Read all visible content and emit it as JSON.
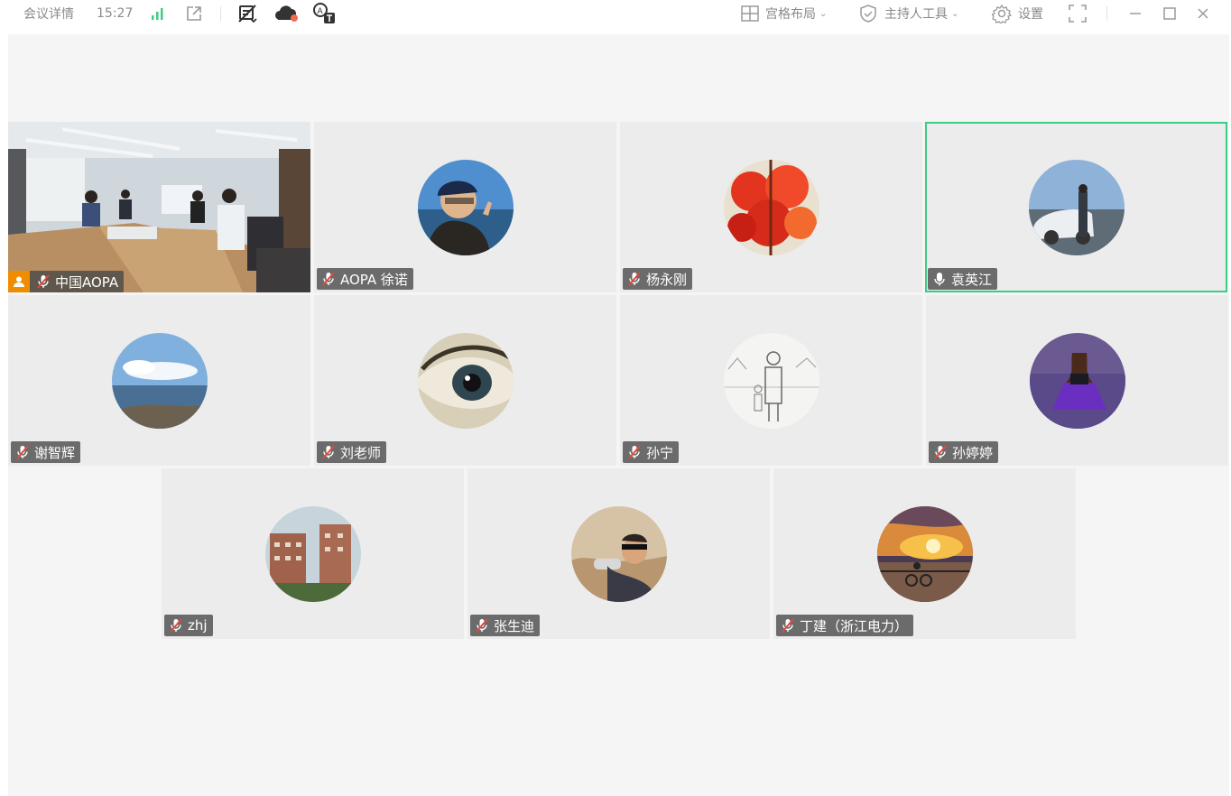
{
  "topbar": {
    "meeting_details": "会议详情",
    "time": "15:27",
    "layout_label": "宫格布局",
    "host_tools_label": "主持人工具",
    "settings_label": "设置"
  },
  "participants": [
    {
      "name": "中国AOPA",
      "muted": true,
      "host": true,
      "video": true
    },
    {
      "name": "AOPA 徐诺",
      "muted": true
    },
    {
      "name": "杨永刚",
      "muted": true
    },
    {
      "name": "袁英江",
      "muted": false,
      "speaking": true
    },
    {
      "name": "谢智辉",
      "muted": true
    },
    {
      "name": "刘老师",
      "muted": true
    },
    {
      "name": "孙宁",
      "muted": true
    },
    {
      "name": "孙婷婷",
      "muted": true
    },
    {
      "name": "zhj",
      "muted": true
    },
    {
      "name": "张生迪",
      "muted": true
    },
    {
      "name": "丁建（浙江电力）",
      "muted": true
    }
  ],
  "colors": {
    "accent_speaking": "#3ecb86",
    "host_badge": "#f08c00",
    "signal": "#3ecb86",
    "record_dot": "#f26a4f"
  },
  "icons": [
    "signal-icon",
    "share-out-icon",
    "caption-off-icon",
    "cloud-record-icon",
    "translate-icon",
    "grid-layout-icon",
    "shield-icon",
    "gear-icon",
    "fullscreen-icon",
    "minimize-icon",
    "maximize-icon",
    "close-icon",
    "mic-muted-icon",
    "mic-icon",
    "host-icon"
  ]
}
